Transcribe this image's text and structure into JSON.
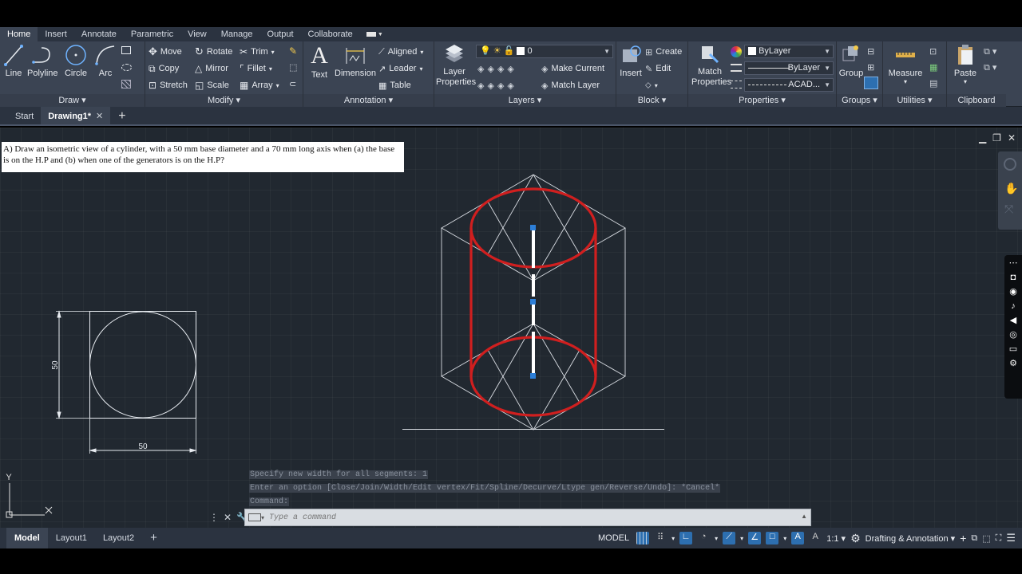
{
  "ribbon_tabs": [
    "Home",
    "Insert",
    "Annotate",
    "Parametric",
    "View",
    "Manage",
    "Output",
    "Collaborate"
  ],
  "draw_panel": {
    "line": "Line",
    "polyline": "Polyline",
    "circle": "Circle",
    "arc": "Arc",
    "title": "Draw"
  },
  "modify_panel": {
    "move": "Move",
    "rotate": "Rotate",
    "trim": "Trim",
    "copy": "Copy",
    "mirror": "Mirror",
    "fillet": "Fillet",
    "stretch": "Stretch",
    "scale": "Scale",
    "array": "Array",
    "title": "Modify"
  },
  "annotation_panel": {
    "text": "Text",
    "dimension": "Dimension",
    "aligned": "Aligned",
    "leader": "Leader",
    "table": "Table",
    "title": "Annotation"
  },
  "layers_panel": {
    "layer_properties": "Layer Properties",
    "current_layer": "0",
    "make_current": "Make Current",
    "match_layer": "Match Layer",
    "title": "Layers"
  },
  "block_panel": {
    "insert": "Insert",
    "create": "Create",
    "edit": "Edit",
    "title": "Block"
  },
  "properties_panel": {
    "match_properties": "Match Properties",
    "color": "ByLayer",
    "lineweight": "ByLayer",
    "linetype": "ACAD...",
    "title": "Properties"
  },
  "groups_panel": {
    "group": "Group",
    "title": "Groups"
  },
  "utilities_panel": {
    "measure": "Measure",
    "title": "Utilities"
  },
  "clipboard_panel": {
    "paste": "Paste",
    "title": "Clipboard"
  },
  "file_tabs": {
    "start": "Start",
    "drawing": "Drawing1*"
  },
  "question_text": "A) Draw an isometric view of a cylinder, with a 50 mm base diameter and a 70 mm long axis when (a) the base is on the H.P and (b) when one of the generators is on the H.P?",
  "dimensions": {
    "vertical": "50",
    "horizontal": "50"
  },
  "ucs": {
    "x": "X",
    "y": "Y"
  },
  "command_history": [
    "Specify new width for all segments: 1",
    "Enter an option [Close/Join/Width/Edit vertex/Fit/Spline/Decurve/Ltype gen/Reverse/Undo]: *Cancel*",
    "Command:"
  ],
  "command_placeholder": "Type a command",
  "layout_tabs": [
    "Model",
    "Layout1",
    "Layout2"
  ],
  "status": {
    "model": "MODEL",
    "scale": "1:1",
    "workspace": "Drafting & Annotation"
  },
  "colors": {
    "accent": "#2d6fb0",
    "cylinder": "#d01f1f",
    "canvas": "#212830",
    "ribbon": "#3b4453"
  }
}
